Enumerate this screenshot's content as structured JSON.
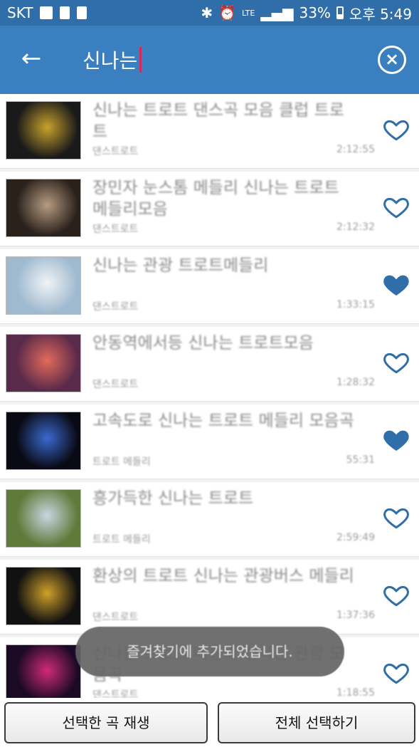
{
  "status_bar": {
    "carrier": "SKT",
    "battery": "33%",
    "time": "오후 5:49",
    "network": "LTE"
  },
  "search": {
    "query": "신나는"
  },
  "songs": [
    {
      "title": "신나는 트로트 댄스곡 모음 클럽 트로트",
      "artist": "댄스트로트",
      "duration": "2:12:55",
      "favorite": false,
      "thumb_color": "#1a1a1a",
      "thumb_accent": "#c8a22c"
    },
    {
      "title": "장민자 눈스톰 메들리 신나는 트로트 메들리모음",
      "artist": "댄스트로트",
      "duration": "2:12:32",
      "favorite": false,
      "thumb_color": "#2a211b",
      "thumb_accent": "#b69b82"
    },
    {
      "title": "신나는 관광 트로트메들리",
      "artist": "댄스트로트",
      "duration": "1:33:15",
      "favorite": true,
      "thumb_color": "#9fb9cf",
      "thumb_accent": "#f0f4f6"
    },
    {
      "title": "안동역에서등 신나는 트로트모음",
      "artist": "댄스트로트",
      "duration": "1:28:32",
      "favorite": false,
      "thumb_color": "#5a2a4a",
      "thumb_accent": "#e36a5a"
    },
    {
      "title": "고속도로 신나는 트로트 메들리 모음곡",
      "artist": "트로트 메들리",
      "duration": "55:31",
      "favorite": true,
      "thumb_color": "#0a0a14",
      "thumb_accent": "#3a6ad0"
    },
    {
      "title": "흥가득한 신나는 트로트",
      "artist": "트로트 메들리",
      "duration": "2:59:49",
      "favorite": false,
      "thumb_color": "#5f7a3a",
      "thumb_accent": "#c9d6e2"
    },
    {
      "title": "환상의 트로트 신나는 관광버스 메들리",
      "artist": "댄스트로트",
      "duration": "1:37:36",
      "favorite": false,
      "thumb_color": "#111111",
      "thumb_accent": "#d0a12a"
    },
    {
      "title": "신나는 트로트 메들리 신나는 관광 모음곡",
      "artist": "댄스트로트",
      "duration": "1:18:55",
      "favorite": false,
      "thumb_color": "#1a0a24",
      "thumb_accent": "#d02a7a"
    }
  ],
  "toast": {
    "message": "즐겨찾기에 추가되었습니다."
  },
  "buttons": {
    "play_selected": "선택한 곡 재생",
    "select_all": "전체 선택하기"
  },
  "colors": {
    "status_bar": "#2f6ea8",
    "app_bar": "#3a7fc0",
    "heart": "#2f6ea8"
  }
}
